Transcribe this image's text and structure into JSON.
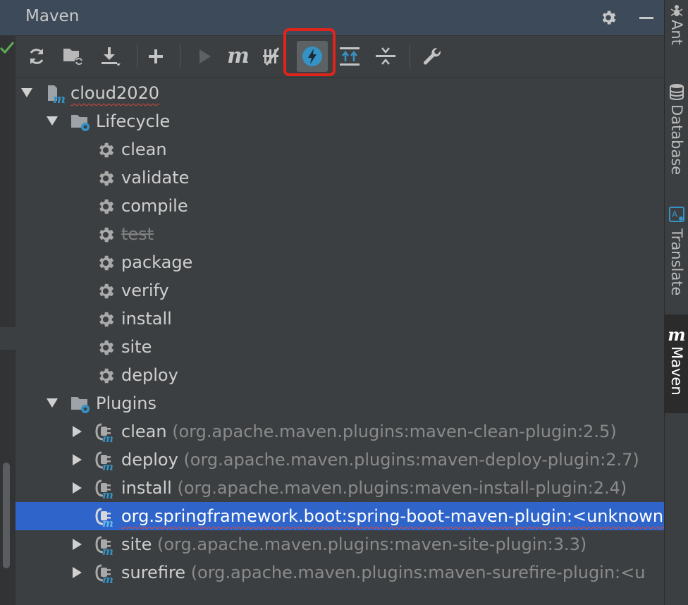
{
  "panel": {
    "title": "Maven",
    "settings_icon": "gear-icon",
    "hide_icon": "minimize-icon"
  },
  "toolbar": {
    "buttons": [
      {
        "name": "reload-all-maven-projects-icon"
      },
      {
        "name": "generate-sources-icon"
      },
      {
        "name": "download-sources-icon"
      },
      {
        "name": "add-maven-project-icon"
      },
      {
        "name": "run-maven-build-icon"
      },
      {
        "name": "execute-maven-goal-icon",
        "label": "m"
      },
      {
        "name": "toggle-offline-mode-icon"
      },
      {
        "name": "skip-tests-mode-icon"
      },
      {
        "name": "show-dependencies-icon"
      },
      {
        "name": "collapse-all-icon"
      },
      {
        "name": "maven-settings-wrench-icon"
      }
    ],
    "highlight_color": "#e0241b"
  },
  "tree": {
    "project": "cloud2020",
    "lifecycle_label": "Lifecycle",
    "lifecycle": [
      "clean",
      "validate",
      "compile",
      "test",
      "package",
      "verify",
      "install",
      "site",
      "deploy"
    ],
    "plugins_label": "Plugins",
    "plugins": [
      {
        "name": "clean",
        "coord": "(org.apache.maven.plugins:maven-clean-plugin:2.5)"
      },
      {
        "name": "deploy",
        "coord": "(org.apache.maven.plugins:maven-deploy-plugin:2.7)"
      },
      {
        "name": "install",
        "coord": "(org.apache.maven.plugins:maven-install-plugin:2.4)"
      },
      {
        "name": "org.springframework.boot:spring-boot-maven-plugin:<unknown>",
        "coord": ""
      },
      {
        "name": "site",
        "coord": "(org.apache.maven.plugins:maven-site-plugin:3.3)"
      },
      {
        "name": "surefire",
        "coord": "(org.apache.maven.plugins:maven-surefire-plugin:<u"
      }
    ]
  },
  "sidebar": {
    "tabs": [
      {
        "label": "Ant",
        "icon": "ant-icon"
      },
      {
        "label": "Database",
        "icon": "database-icon"
      },
      {
        "label": "Translate",
        "icon": "translate-icon"
      },
      {
        "label": "Maven",
        "icon": "maven-icon",
        "icon_text": "m"
      }
    ]
  },
  "colors": {
    "background": "#3c3f41",
    "selection": "#2f65ca",
    "accent_blue": "#3592c4",
    "highlight": "#e0241b"
  }
}
